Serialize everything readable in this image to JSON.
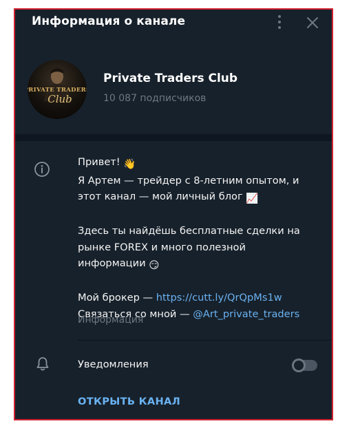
{
  "header": {
    "title": "Информация о канале",
    "menu_icon": "more-vertical-icon",
    "close_icon": "close-icon"
  },
  "channel": {
    "name": "Private Traders Club",
    "subscribers": "10 087 подписчиков",
    "avatar_text_line1": "PRIVATE TRADERS",
    "avatar_text_line2": "Club"
  },
  "about": {
    "line1": "Привет! ",
    "line1_emoji": "👋",
    "line2": "Я Артем — трейдер с 8-летним опытом, и",
    "line3": "этот канал — мой личный блог ",
    "line3_emoji": "📈",
    "line4": "Здесь ты найдёшь бесплатные сделки на",
    "line5": "рынке FOREX и много полезной",
    "line6": "информации ",
    "line6_emoji": "😏",
    "broker_prefix": "Мой брокер — ",
    "broker_link": "https://cutt.ly/QrQpMs1w",
    "contact_prefix": "Связаться со мной — ",
    "contact_link": "@Art_private_traders",
    "caption": "Информация"
  },
  "notifications": {
    "label": "Уведомления",
    "enabled": false
  },
  "actions": {
    "open_channel": "ОТКРЫТЬ КАНАЛ"
  },
  "colors": {
    "background": "#17212b",
    "band": "#0e1621",
    "accent_link": "#6ab2f2",
    "muted": "#6d7883",
    "frame_border": "#d32030"
  }
}
